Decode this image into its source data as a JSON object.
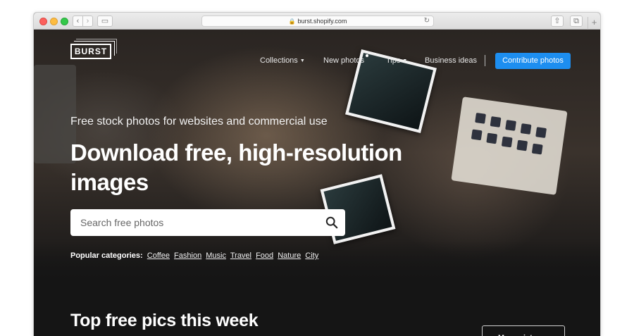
{
  "browser": {
    "url": "burst.shopify.com",
    "back_glyph": "‹",
    "forward_glyph": "›",
    "sidebar_glyph": "▭",
    "share_glyph": "⇧",
    "tabs_glyph": "⧉",
    "new_tab_glyph": "+",
    "lock_glyph": "🔒",
    "reload_glyph": "↻"
  },
  "header": {
    "logo": "BURST",
    "nav": {
      "collections": "Collections",
      "new_photos": "New photos",
      "tips": "Tips",
      "business_ideas": "Business ideas",
      "caret": "▼"
    },
    "contribute_label": "Contribute photos"
  },
  "hero": {
    "tagline": "Free stock photos for websites and commercial use",
    "headline": "Download free, high-resolution images",
    "search": {
      "placeholder": "Search free photos",
      "icon": "search-icon"
    },
    "popular_label": "Popular categories:",
    "categories": [
      "Coffee",
      "Fashion",
      "Music",
      "Travel",
      "Food",
      "Nature",
      "City"
    ]
  },
  "section": {
    "title": "Top free pics this week",
    "more_label": "More pictures"
  },
  "colors": {
    "accent": "#1d8ef0",
    "background": "#151515"
  }
}
